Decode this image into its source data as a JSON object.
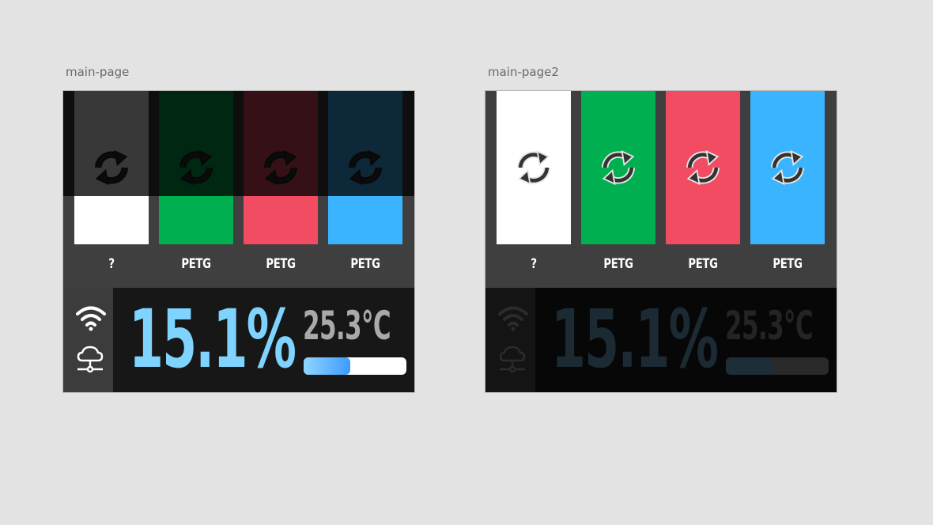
{
  "artboards": [
    {
      "label": "main-page",
      "active": true,
      "slots": [
        {
          "material": "?",
          "color": "#ffffff",
          "icon": "sync-icon"
        },
        {
          "material": "PETG",
          "color": "#00b050",
          "icon": "sync-icon"
        },
        {
          "material": "PETG",
          "color": "#f24c63",
          "icon": "sync-icon"
        },
        {
          "material": "PETG",
          "color": "#3bb4ff",
          "icon": "sync-icon"
        }
      ],
      "status": {
        "wifi_icon": "wifi-icon",
        "cloud_icon": "cloud-network-icon",
        "percent": "15.1%",
        "temperature": "25.3°C",
        "progress": 0.45
      },
      "colors": {
        "percent": "#7fd3ff",
        "temperature": "#a9a9a9",
        "progress_fill": "#4aa8ff",
        "progress_track": "#ffffff",
        "panel": "#171717",
        "status_column": "#3c3c3c"
      }
    },
    {
      "label": "main-page2",
      "active": false,
      "slots": [
        {
          "material": "?",
          "color": "#ffffff",
          "icon": "sync-icon"
        },
        {
          "material": "PETG",
          "color": "#00b050",
          "icon": "sync-icon"
        },
        {
          "material": "PETG",
          "color": "#f24c63",
          "icon": "sync-icon"
        },
        {
          "material": "PETG",
          "color": "#3bb4ff",
          "icon": "sync-icon"
        }
      ],
      "status": {
        "wifi_icon": "wifi-icon",
        "cloud_icon": "cloud-network-icon",
        "percent": "15.1%",
        "temperature": "25.3°C",
        "progress": 0.45
      },
      "colors": {
        "percent": "#1b2a33",
        "temperature": "#242424",
        "progress_fill": "#1d2e38",
        "progress_track": "#2a2a2a",
        "panel": "#070707",
        "status_column": "#141414"
      }
    }
  ]
}
